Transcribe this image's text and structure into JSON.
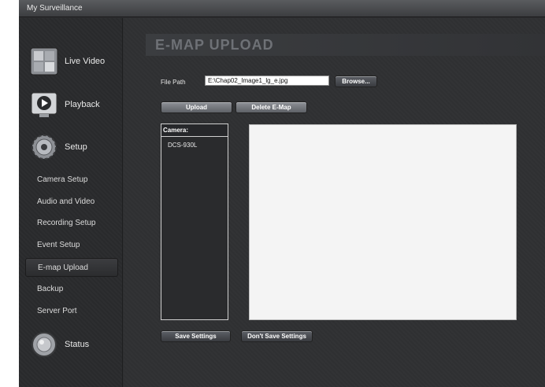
{
  "window": {
    "title": "My Surveillance"
  },
  "sidebar": {
    "main_items": [
      {
        "label": "Live Video",
        "icon": "live-video-icon"
      },
      {
        "label": "Playback",
        "icon": "playback-icon"
      },
      {
        "label": "Setup",
        "icon": "setup-gear-icon"
      }
    ],
    "setup_items": [
      {
        "label": "Camera Setup"
      },
      {
        "label": "Audio and Video"
      },
      {
        "label": "Recording Setup"
      },
      {
        "label": "Event Setup"
      },
      {
        "label": "E-map Upload",
        "active": true
      },
      {
        "label": "Backup"
      },
      {
        "label": "Server Port"
      }
    ],
    "status": {
      "label": "Status",
      "icon": "status-icon"
    }
  },
  "page": {
    "title": "E-MAP UPLOAD",
    "file_path_label": "File Path",
    "file_path_value": "E:\\Chap02_Image1_lg_e.jpg",
    "browse_label": "Browse...",
    "upload_label": "Upload",
    "delete_label": "Delete E-Map",
    "camera_header": "Camera:",
    "cameras": [
      "DCS-930L"
    ],
    "save_label": "Save Settings",
    "dont_save_label": "Don't Save Settings"
  },
  "colors": {
    "background": "#2e2f31",
    "title_text": "#6e7176",
    "button": "#7a7d82",
    "map_area": "#f4f4f4"
  }
}
